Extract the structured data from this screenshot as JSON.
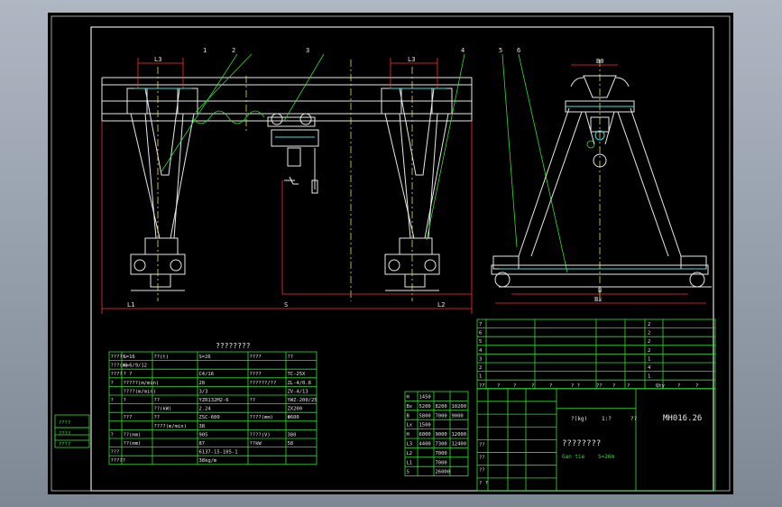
{
  "drawing": {
    "title_block": {
      "drawing_no": "MH016.26",
      "title": "????????",
      "subtitle_left": "Gan tie",
      "subtitle_right": "S=26m",
      "rows": [
        "7",
        "6",
        "5",
        "4",
        "3",
        "2",
        "1"
      ],
      "row_qty": [
        "2",
        "2",
        "2",
        "2",
        "1",
        "4",
        "1"
      ],
      "header": [
        "??",
        "?",
        "?",
        "?",
        "?",
        "? ?",
        "??",
        "?",
        "?",
        "Qty",
        "?",
        "?"
      ],
      "mass_label": "?(kg)",
      "ratio": "1:?",
      "pages": "??",
      "side_labels": [
        "??",
        "??",
        "??",
        "? ?"
      ]
    },
    "spec_table": {
      "title": "????????",
      "rows": [
        [
          "????t",
          "G=16",
          "??(t)",
          "S=26",
          "????",
          "??"
        ],
        [
          "???(m)",
          "H=6/9/12",
          "",
          "",
          "",
          ""
        ],
        [
          "????",
          "? ?",
          "",
          "C4/16",
          "????",
          "TC-25X"
        ],
        [
          "?",
          "?????(m/min)",
          "",
          "20",
          "??????/??",
          "ZL-4/0.8"
        ],
        [
          "",
          "????(m/min)",
          "",
          "3/3",
          "",
          "ZV-4/13"
        ],
        [
          "?",
          "?",
          "??",
          "YZR132M2-6",
          "??",
          "YWZ-200/25"
        ],
        [
          "",
          "",
          "??(kW)",
          "2.24",
          "",
          "ZX200"
        ],
        [
          "",
          "???",
          "??",
          "ZSC-600",
          "????(mm)",
          "Φ600"
        ],
        [
          "",
          "",
          "????(m/min)",
          "38",
          "",
          ""
        ],
        [
          "?",
          "??(mm)",
          "",
          "905",
          "????(V)",
          "380"
        ],
        [
          "",
          "??(mm)",
          "",
          "87",
          "??kW",
          "58"
        ],
        [
          "???",
          "",
          "",
          "6137-15-105-1",
          "",
          ""
        ],
        [
          "?????",
          "",
          "",
          "38kg/m",
          "",
          ""
        ]
      ]
    },
    "dim_table": {
      "rows": [
        [
          "H",
          "1450",
          "",
          ""
        ],
        [
          "Bx",
          "5200",
          "8200",
          "10200"
        ],
        [
          "B",
          "5800",
          "7000",
          "9000"
        ],
        [
          "Lx",
          "1500",
          "",
          ""
        ],
        [
          "H",
          "6000",
          "9000",
          "12000"
        ],
        [
          "L3",
          "4400",
          "7300",
          "12400"
        ],
        [
          "L2",
          "",
          "7000",
          ""
        ],
        [
          "L1",
          "",
          "7000",
          ""
        ],
        [
          "S",
          "",
          "26000",
          ""
        ]
      ]
    },
    "labels": {
      "l1": "L1",
      "l2": "L2",
      "l3a": "L3",
      "l3b": "L3",
      "s": "S",
      "b": "B",
      "bx": "Bx",
      "b0": "B0",
      "callouts": [
        "1",
        "2",
        "3",
        "4",
        "5",
        "6"
      ]
    },
    "left_stamps": [
      "????",
      "????",
      "????"
    ]
  }
}
